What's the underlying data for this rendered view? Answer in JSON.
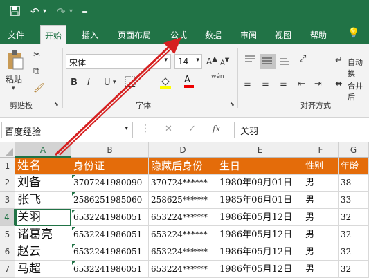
{
  "quick_access": {
    "save_icon": "save-icon",
    "undo_icon": "undo-icon",
    "redo_icon": "redo-icon",
    "customize_icon": "customize-icon"
  },
  "tabs": [
    "文件",
    "开始",
    "插入",
    "页面布局",
    "公式",
    "数据",
    "审阅",
    "视图",
    "帮助"
  ],
  "active_tab": "开始",
  "tell_me_icon": "lightbulb-icon",
  "ribbon": {
    "clipboard": {
      "paste_label": "粘贴",
      "group_label": "剪贴板"
    },
    "font": {
      "name": "宋体",
      "size": "14",
      "bold": "B",
      "italic": "I",
      "underline": "U",
      "font_color_letter": "A",
      "phonetic": "wén",
      "group_label": "字体"
    },
    "alignment": {
      "wrap_label": "自动换",
      "merge_label": "合并后",
      "group_label": "对齐方式"
    }
  },
  "formula_bar": {
    "name_box": "百度经验",
    "cancel": "✕",
    "enter": "✓",
    "fx": "fx",
    "value": "关羽"
  },
  "columns": [
    "A",
    "B",
    "D",
    "E",
    "F",
    "G"
  ],
  "rows": [
    {
      "num": "1",
      "cells": [
        "姓名",
        "身份证",
        "隐藏后身份",
        "生日",
        "性别",
        "年龄"
      ]
    },
    {
      "num": "2",
      "cells": [
        "刘备",
        "3707241980090",
        "370724******",
        "1980年09月01日",
        "男",
        "38"
      ]
    },
    {
      "num": "3",
      "cells": [
        "张飞",
        "2586251985060",
        "258625******",
        "1985年06月01日",
        "男",
        "33"
      ]
    },
    {
      "num": "4",
      "cells": [
        "关羽",
        "6532241986051",
        "653224******",
        "1986年05月12日",
        "男",
        "32"
      ]
    },
    {
      "num": "5",
      "cells": [
        "诸葛亮",
        "6532241986051",
        "653224******",
        "1986年05月12日",
        "男",
        "32"
      ]
    },
    {
      "num": "6",
      "cells": [
        "赵云",
        "6532241986051",
        "653224******",
        "1986年05月12日",
        "男",
        "32"
      ]
    },
    {
      "num": "7",
      "cells": [
        "马超",
        "6532241986051",
        "653224******",
        "1986年05月12日",
        "男",
        "32"
      ]
    }
  ],
  "colors": {
    "excel_green": "#217346",
    "header_fill": "#e46c0a",
    "annotation_arrow": "#d62020"
  }
}
